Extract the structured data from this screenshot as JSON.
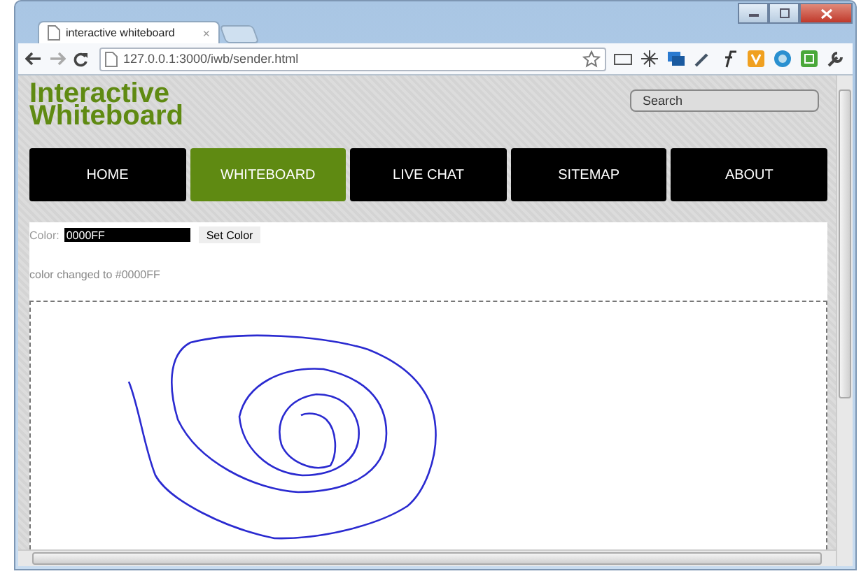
{
  "browser": {
    "tab_title": "interactive whiteboard",
    "tab_close": "×",
    "url": "127.0.0.1:3000/iwb/sender.html"
  },
  "site": {
    "logo": "Interactive Whiteboard",
    "search": {
      "placeholder": "Search"
    }
  },
  "nav": [
    {
      "label": "HOME",
      "selected": false
    },
    {
      "label": "WHITEBOARD",
      "selected": true
    },
    {
      "label": "LIVE CHAT",
      "selected": false
    },
    {
      "label": "SITEMAP",
      "selected": false
    },
    {
      "label": "ABOUT",
      "selected": false
    }
  ],
  "color_form": {
    "label": "Color:",
    "value": "0000FF",
    "button": "Set Color"
  },
  "status_message": "color changed to #0000FF"
}
